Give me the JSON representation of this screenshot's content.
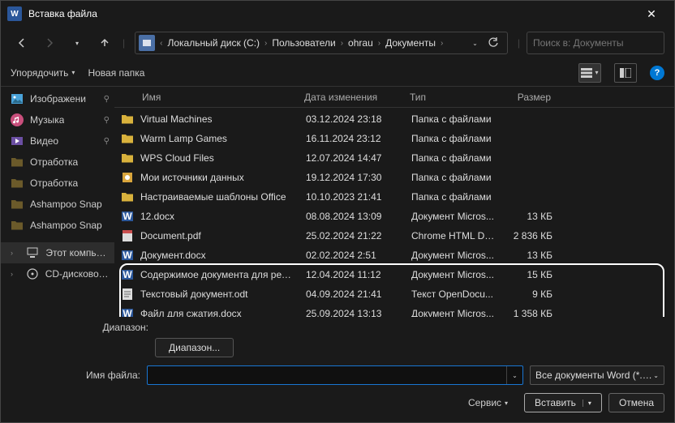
{
  "title": "Вставка файла",
  "breadcrumb": {
    "items": [
      "Локальный диск (C:)",
      "Пользователи",
      "ohrau",
      "Документы"
    ]
  },
  "search": {
    "placeholder": "Поиск в: Документы"
  },
  "toolbar": {
    "organize": "Упорядочить",
    "new_folder": "Новая папка"
  },
  "sidebar": {
    "items": [
      {
        "label": "Изображени",
        "icon": "image",
        "pinned": true
      },
      {
        "label": "Музыка",
        "icon": "music",
        "pinned": true
      },
      {
        "label": "Видео",
        "icon": "video",
        "pinned": true
      },
      {
        "label": "Отработка",
        "icon": "folder-dark"
      },
      {
        "label": "Отработка",
        "icon": "folder-dark"
      },
      {
        "label": "Ashampoo Snap",
        "icon": "folder-dark"
      },
      {
        "label": "Ashampoo Snap",
        "icon": "folder-dark"
      },
      {
        "label": "Этот компьюте",
        "icon": "pc",
        "expandable": true,
        "selected": true,
        "sep": true
      },
      {
        "label": "CD-дисковод (D",
        "icon": "cd",
        "expandable": true
      }
    ]
  },
  "columns": {
    "name": "Имя",
    "date": "Дата изменения",
    "type": "Тип",
    "size": "Размер"
  },
  "rows": [
    {
      "icon": "folder",
      "name": "Virtual Machines",
      "date": "03.12.2024 23:18",
      "type": "Папка с файлами",
      "size": ""
    },
    {
      "icon": "folder",
      "name": "Warm Lamp Games",
      "date": "16.11.2024 23:12",
      "type": "Папка с файлами",
      "size": ""
    },
    {
      "icon": "folder",
      "name": "WPS Cloud Files",
      "date": "12.07.2024 14:47",
      "type": "Папка с файлами",
      "size": ""
    },
    {
      "icon": "generic",
      "name": "Мои источники данных",
      "date": "19.12.2024 17:30",
      "type": "Папка с файлами",
      "size": ""
    },
    {
      "icon": "folder",
      "name": "Настраиваемые шаблоны Office",
      "date": "10.10.2023 21:41",
      "type": "Папка с файлами",
      "size": ""
    },
    {
      "icon": "word",
      "name": "12.docx",
      "date": "08.08.2024 13:09",
      "type": "Документ Micros...",
      "size": "13 КБ"
    },
    {
      "icon": "pdf",
      "name": "Document.pdf",
      "date": "25.02.2024 21:22",
      "type": "Chrome HTML Do...",
      "size": "2 836 КБ"
    },
    {
      "icon": "word",
      "name": "Документ.docx",
      "date": "02.02.2024 2:51",
      "type": "Документ Micros...",
      "size": "13 КБ"
    },
    {
      "icon": "word",
      "name": "Содержимое документа для редактиро...",
      "date": "12.04.2024 11:12",
      "type": "Документ Micros...",
      "size": "15 КБ"
    },
    {
      "icon": "txt",
      "name": "Текстовый документ.odt",
      "date": "04.09.2024 21:41",
      "type": "Текст OpenDocu...",
      "size": "9 КБ"
    },
    {
      "icon": "word",
      "name": "Файл для сжатия.docx",
      "date": "25.09.2024 13:13",
      "type": "Документ Micros...",
      "size": "1 358 КБ"
    }
  ],
  "range": {
    "label": "Диапазон:",
    "button": "Диапазон..."
  },
  "filename": {
    "label": "Имя файла:",
    "value": ""
  },
  "filter": {
    "label": "Все документы Word (*.docx;"
  },
  "tools": "Сервис",
  "buttons": {
    "insert": "Вставить",
    "cancel": "Отмена"
  }
}
